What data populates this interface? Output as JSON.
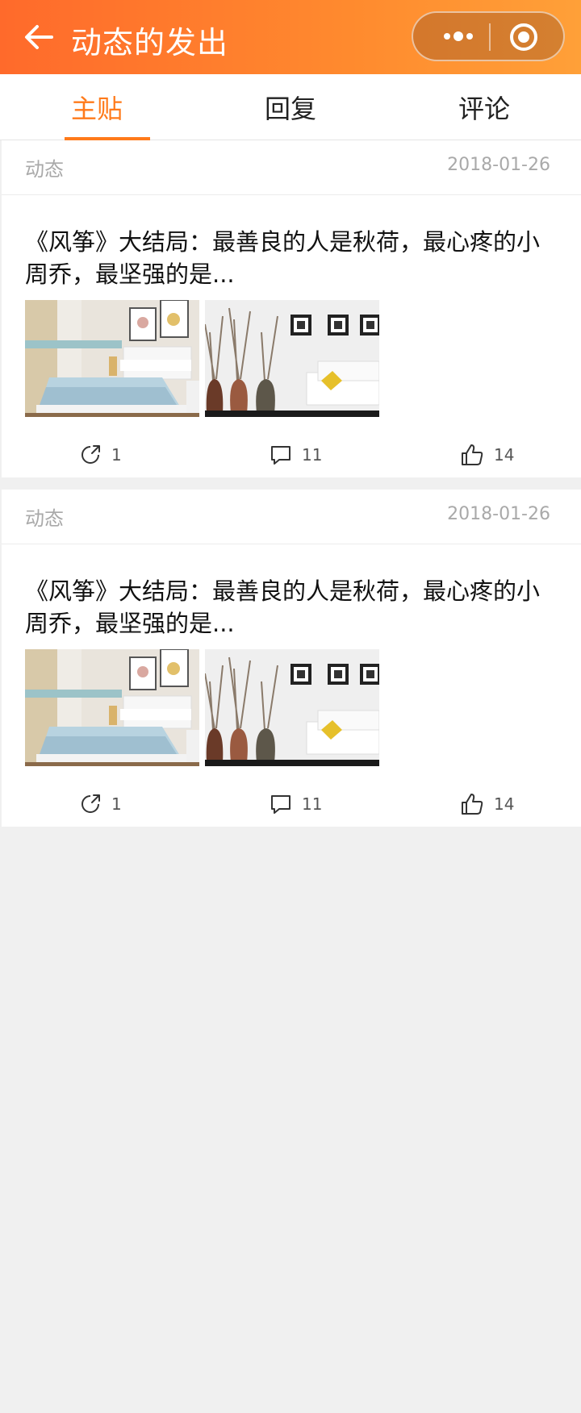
{
  "header": {
    "title": "动态的发出",
    "back_icon": "arrow-left-icon",
    "gradient": [
      "#ff6a2b",
      "#ffa038"
    ]
  },
  "tabs": [
    {
      "label": "主贴",
      "active": true
    },
    {
      "label": "回复",
      "active": false
    },
    {
      "label": "评论",
      "active": false
    }
  ],
  "accent_color": "#ff7a1a",
  "posts": [
    {
      "type": "动态",
      "date": "2018-01-26",
      "title": "《风筝》大结局：最善良的人是秋荷，最心疼的小周乔，最坚强的是...",
      "images": [
        "bedroom-photo",
        "vases-living-room-photo"
      ],
      "shares": "1",
      "comments": "11",
      "likes": "14"
    },
    {
      "type": "动态",
      "date": "2018-01-26",
      "title": "《风筝》大结局：最善良的人是秋荷，最心疼的小周乔，最坚强的是...",
      "images": [
        "bedroom-photo",
        "vases-living-room-photo"
      ],
      "shares": "1",
      "comments": "11",
      "likes": "14"
    }
  ]
}
